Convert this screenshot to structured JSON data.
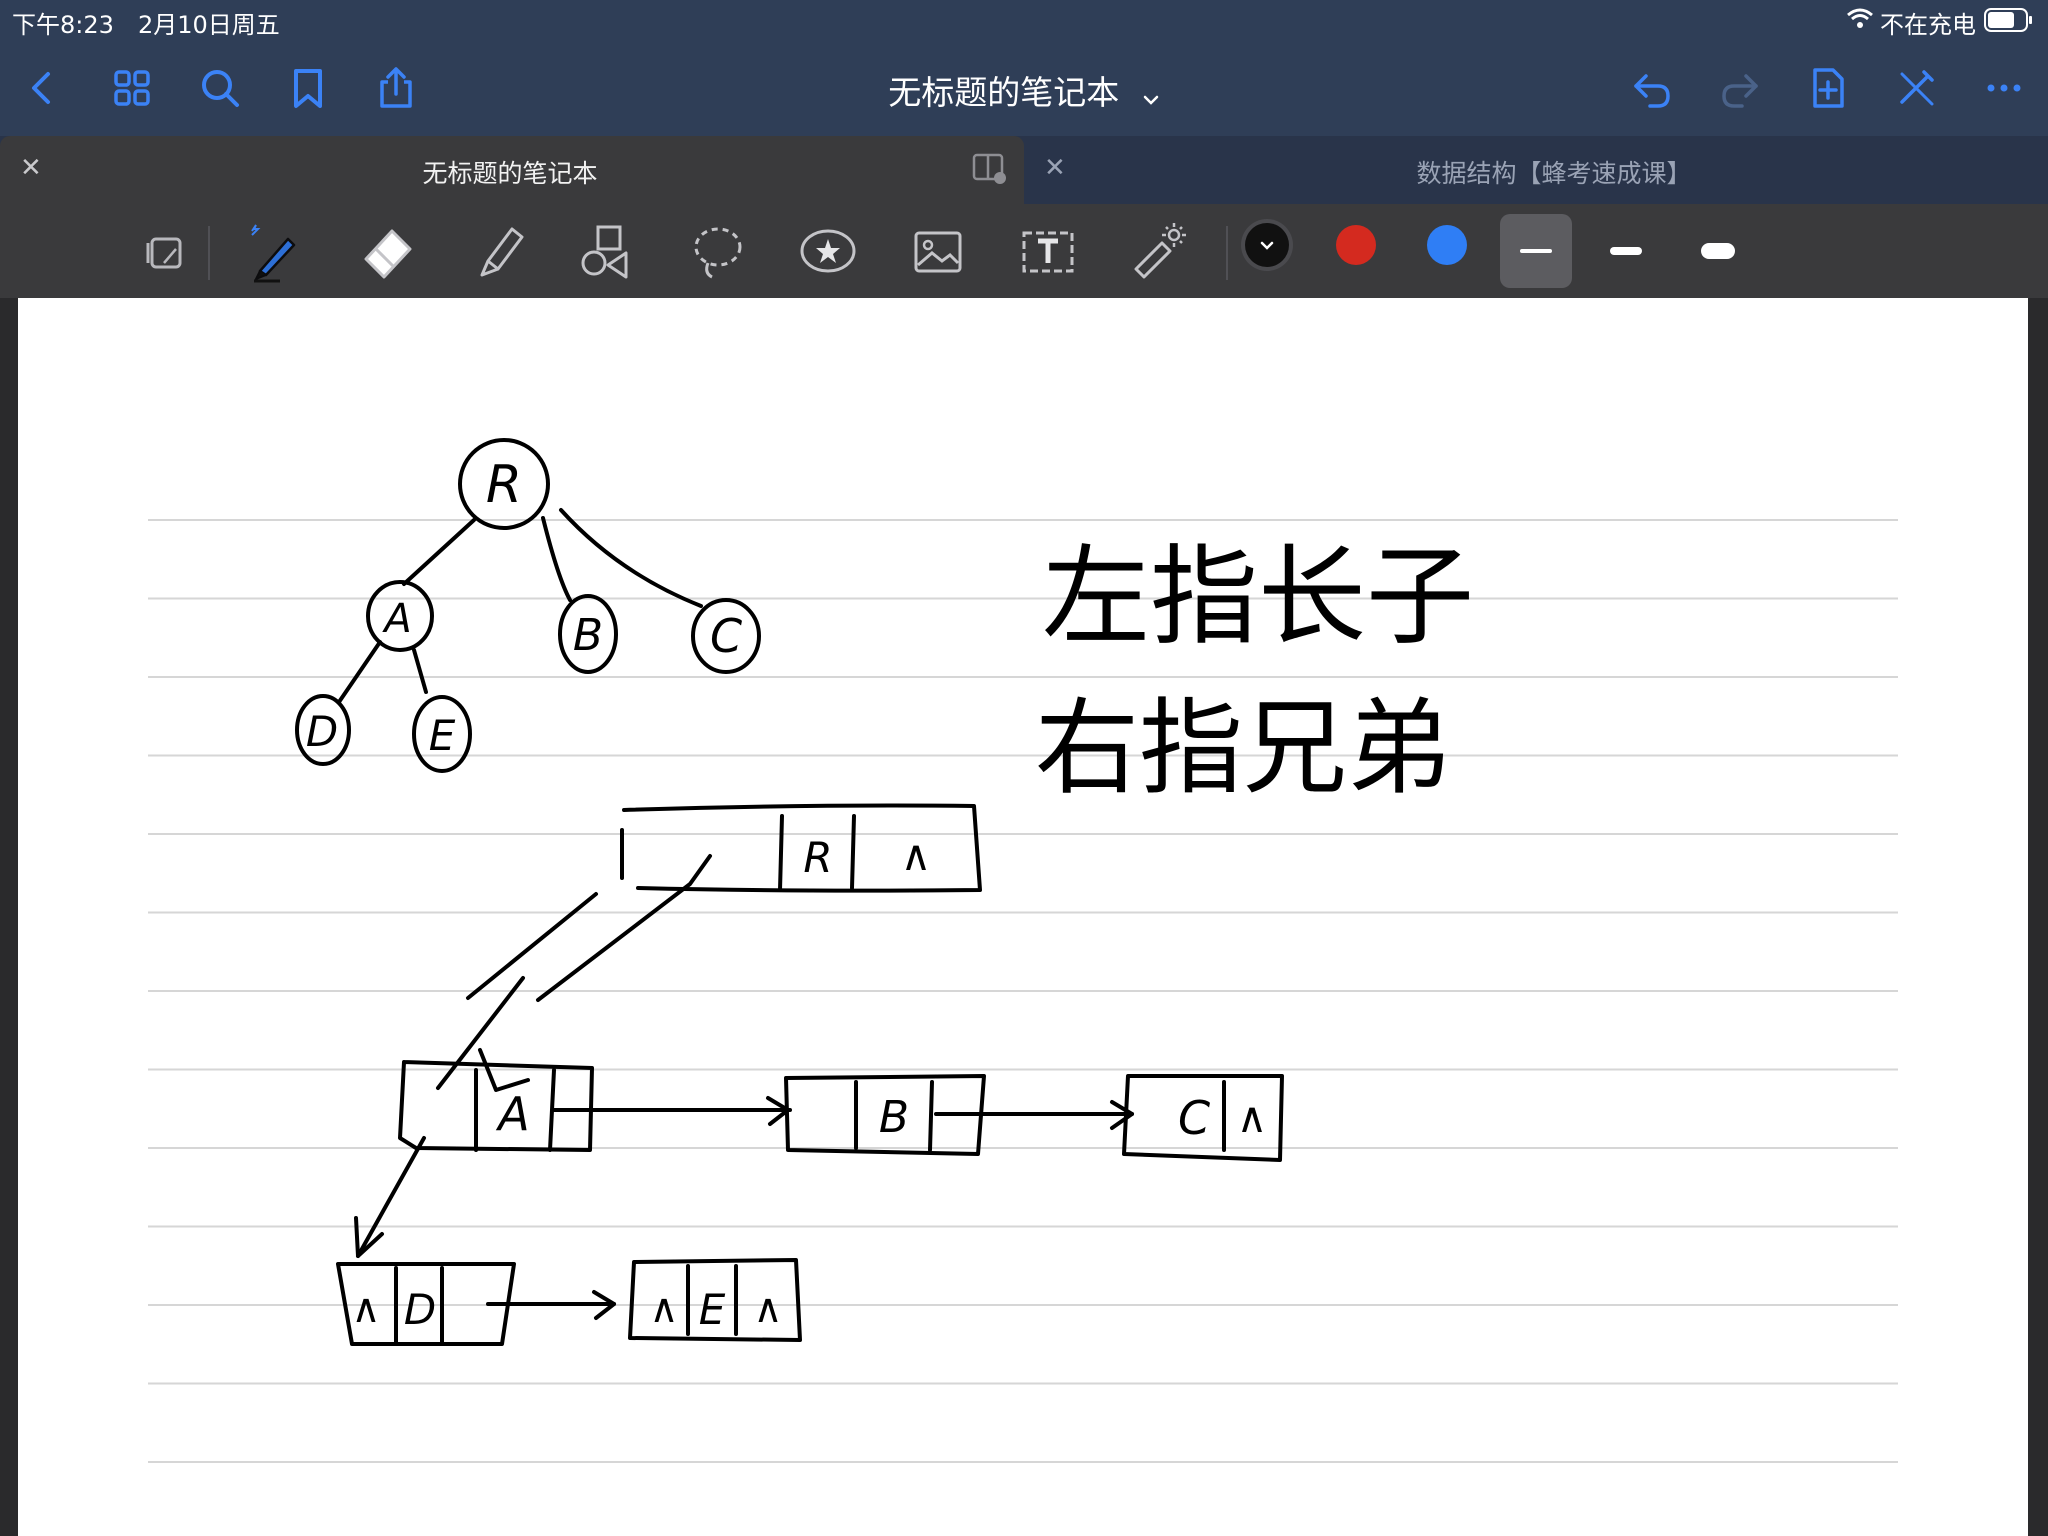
{
  "status_bar": {
    "time": "下午8:23",
    "date": "2月10日周五",
    "charging": "不在充电"
  },
  "nav_bar": {
    "title": "无标题的笔记本",
    "left_icons": [
      "chevron-left-icon",
      "grid-icon",
      "search-icon",
      "bookmark-icon",
      "share-icon"
    ],
    "right_icons": [
      "undo-icon",
      "redo-icon",
      "add-page-icon",
      "pen-off-icon",
      "more-icon"
    ]
  },
  "tabs": [
    {
      "title": "无标题的笔记本",
      "active": true
    },
    {
      "title": "数据结构【蜂考速成课】",
      "active": false
    }
  ],
  "toolbar": {
    "tools": [
      "read-mode-icon",
      "pen-icon",
      "eraser-icon",
      "highlighter-icon",
      "shapes-icon",
      "lasso-icon",
      "sticker-icon",
      "image-icon",
      "text-box-icon",
      "laser-pointer-icon"
    ],
    "selected_tool": "pen",
    "colors": [
      "#111111",
      "#d42a1f",
      "#2f7ef5"
    ],
    "selected_color": "#111111",
    "stroke_widths": [
      "thin",
      "medium",
      "thick"
    ],
    "selected_stroke": "thin"
  },
  "canvas": {
    "paper": "lined",
    "handwriting": {
      "tree_nodes": [
        "R",
        "A",
        "B",
        "C",
        "D",
        "E"
      ],
      "rules": [
        "左指长子",
        "右指兄弟"
      ],
      "list_cells": [
        "R",
        "∧",
        "A",
        "B",
        "C",
        "D",
        "E"
      ]
    }
  }
}
